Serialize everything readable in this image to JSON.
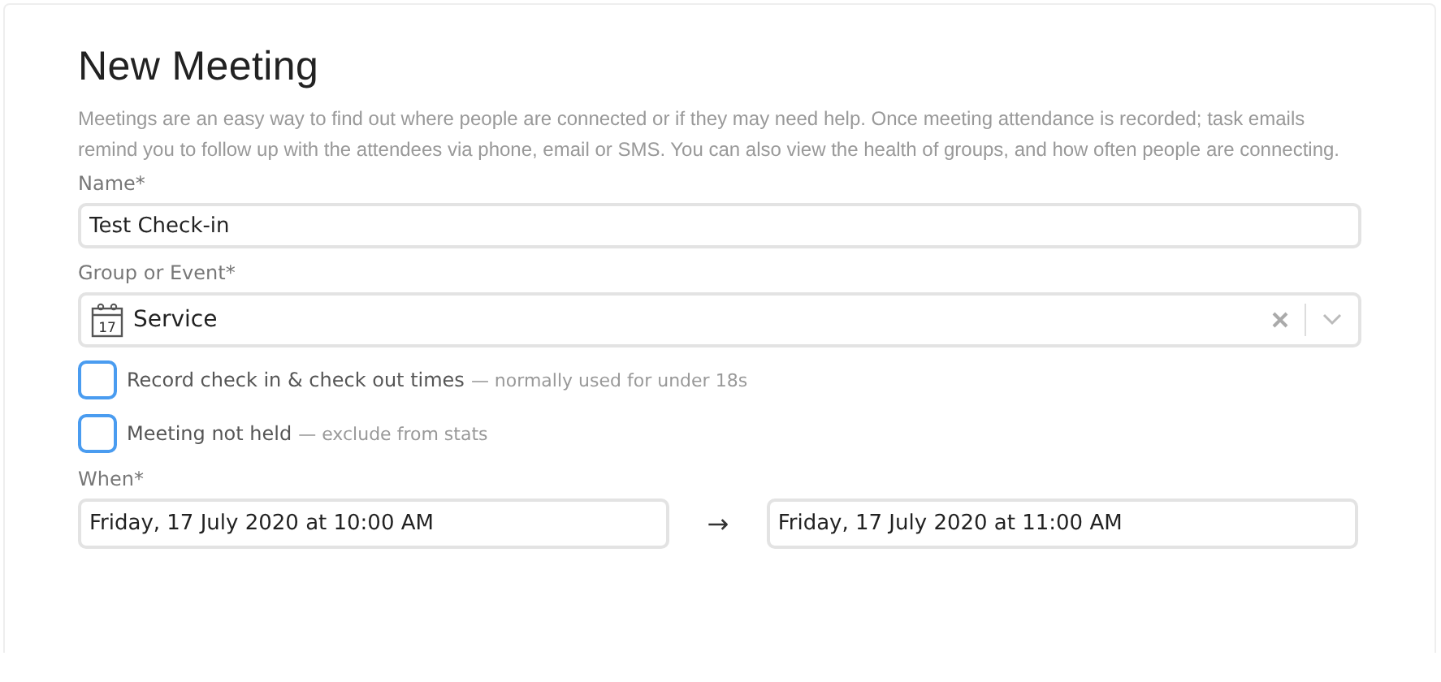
{
  "title": "New Meeting",
  "description": "Meetings are an easy way to find out where people are connected or if they may need help. Once meeting attendance is recorded; task emails remind you to follow up with the attendees via phone, email or SMS. You can also view the health of groups, and how often people are connecting.",
  "name_field": {
    "label": "Name*",
    "value": "Test Check-in"
  },
  "group_field": {
    "label": "Group or Event*",
    "icon_day": "17",
    "value": "Service"
  },
  "options": [
    {
      "label": "Record check in & check out times",
      "hint": "— normally used for under 18s",
      "checked": false
    },
    {
      "label": "Meeting not held",
      "hint": "— exclude from stats",
      "checked": false
    }
  ],
  "when": {
    "label": "When*",
    "start": "Friday, 17 July 2020 at 10:00 AM",
    "arrow": "→",
    "end": "Friday, 17 July 2020 at 11:00 AM"
  }
}
